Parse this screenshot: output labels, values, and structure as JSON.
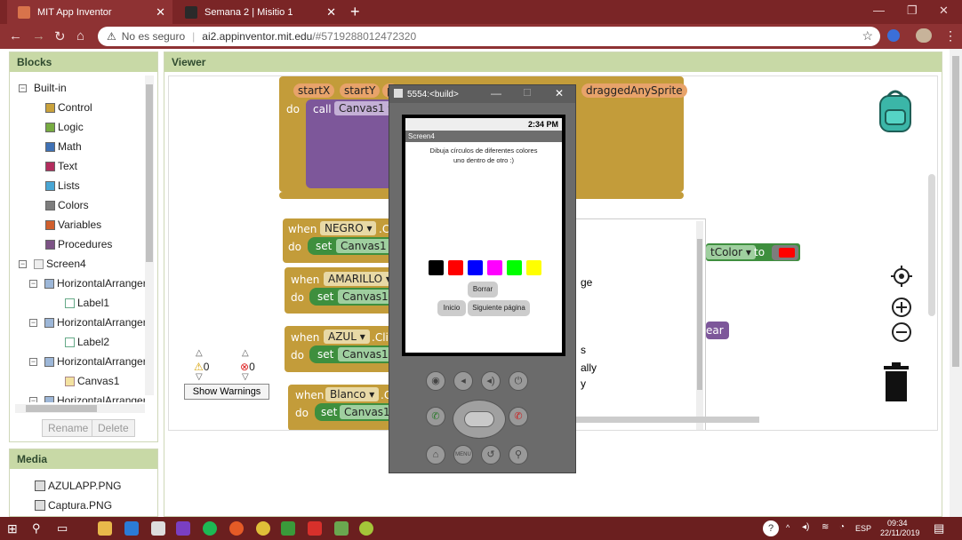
{
  "browser": {
    "tabs": [
      {
        "title": "MIT App Inventor",
        "favicon_color": "#d8734b"
      },
      {
        "title": "Semana 2 | Misitio 1",
        "favicon_color": "#2a2a2a"
      }
    ],
    "security_label": "No es seguro",
    "url_host": "ai2.appinventor.mit.edu",
    "url_path": "/#5719288012472320"
  },
  "blocks_panel": {
    "title": "Blocks",
    "builtin_label": "Built-in",
    "builtin_items": [
      {
        "label": "Control",
        "color": "#c9a23c"
      },
      {
        "label": "Logic",
        "color": "#77ab41"
      },
      {
        "label": "Math",
        "color": "#3f71b5"
      },
      {
        "label": "Text",
        "color": "#b32d5e"
      },
      {
        "label": "Lists",
        "color": "#49a6d4"
      },
      {
        "label": "Colors",
        "color": "#7d7d7d"
      },
      {
        "label": "Variables",
        "color": "#d05f2d"
      },
      {
        "label": "Procedures",
        "color": "#7c5385"
      }
    ],
    "screen_label": "Screen4",
    "components": [
      {
        "label": "HorizontalArranger",
        "level": 1
      },
      {
        "label": "Label1",
        "level": 2
      },
      {
        "label": "HorizontalArranger",
        "level": 1
      },
      {
        "label": "Label2",
        "level": 2
      },
      {
        "label": "HorizontalArranger",
        "level": 1
      },
      {
        "label": "Canvas1",
        "level": 2
      },
      {
        "label": "HorizontalArranger",
        "level": 1
      }
    ],
    "rename_label": "Rename",
    "delete_label": "Delete"
  },
  "media_panel": {
    "title": "Media",
    "items": [
      "AZULAPP.PNG",
      "Captura.PNG"
    ]
  },
  "viewer": {
    "title": "Viewer",
    "top_block": {
      "params": [
        "startX",
        "startY",
        "p"
      ],
      "param_right": "draggedAnySprite",
      "do_label": "do",
      "call_label": "call",
      "canvas": "Canvas1"
    },
    "when_blocks": [
      {
        "when": "when",
        "component": "NEGRO",
        "event": ".C",
        "do": "do",
        "set": "set",
        "canvas": "Canvas1"
      },
      {
        "when": "when",
        "component": "AMARILLO",
        "event": ".",
        "do": "do",
        "set": "set",
        "canvas": "Canvas1"
      },
      {
        "when": "when",
        "component": "AZUL",
        "event": ".Clic",
        "do": "do",
        "set": "set",
        "canvas": "Canvas1"
      },
      {
        "when": "when",
        "component": "Blanco",
        "event": ".C",
        "do": "do",
        "set": "set",
        "canvas": "Canvas1"
      }
    ],
    "color_block": {
      "prop": "tColor",
      "to": "to"
    },
    "clear_label": "ear",
    "bg_fragments": [
      "ge",
      "s",
      "ally",
      "y"
    ],
    "warnings": {
      "count": "0",
      "errors": "0",
      "button": "Show Warnings"
    }
  },
  "emulator": {
    "title": "5554:<build>",
    "time": "2:34 PM",
    "screen_name": "Screen4",
    "instruction": "Dibuja círculos de diferentes colores",
    "instruction2": "uno dentro de otro :)",
    "swatches": [
      "#000000",
      "#ff0000",
      "#0000ff",
      "#ff00ff",
      "#00ff00",
      "#ffff00"
    ],
    "borrar": "Borrar",
    "inicio": "Inicio",
    "siguiente": "Siguiente página",
    "menu_label": "MENU"
  },
  "taskbar": {
    "lang": "ESP",
    "time": "09:34",
    "date": "22/11/2019"
  }
}
